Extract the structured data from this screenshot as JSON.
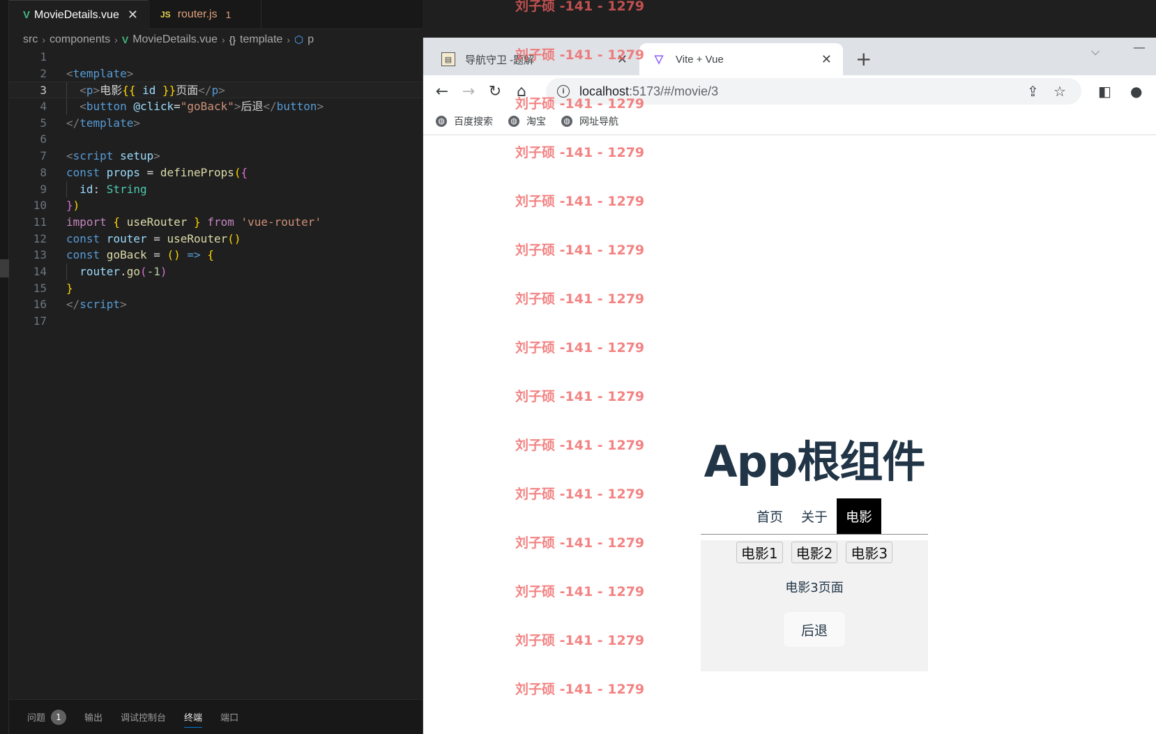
{
  "editor": {
    "tabs": [
      {
        "label": "MovieDetails.vue",
        "icon": "vue-icon",
        "active": true
      },
      {
        "label": "router.js",
        "icon": "js-icon",
        "problems": "1"
      }
    ],
    "breadcrumb": [
      "src",
      "components",
      "MovieDetails.vue",
      "template",
      "p"
    ],
    "line_numbers": [
      "1",
      "2",
      "3",
      "4",
      "5",
      "6",
      "7",
      "8",
      "9",
      "10",
      "11",
      "12",
      "13",
      "14",
      "15",
      "16",
      "17"
    ],
    "code": {
      "l2_open": "<",
      "l2_tag": "template",
      "l2_close": ">",
      "l3_open": "<",
      "l3_tag": "p",
      "l3_close": ">",
      "l3_text1": "电影",
      "l3_mus_open": "{{ ",
      "l3_var": "id",
      "l3_mus_close": " }}",
      "l3_text2": "页面",
      "l3_end_open": "</",
      "l3_end_tag": "p",
      "l3_end_close": ">",
      "l4_open": "<",
      "l4_tag": "button",
      "l4_attr": " @click",
      "l4_eq": "=",
      "l4_str": "\"goBack\"",
      "l4_close": ">",
      "l4_text": "后退",
      "l4_end_open": "</",
      "l4_end_tag": "button",
      "l4_end_close": ">",
      "l5_open": "</",
      "l5_tag": "template",
      "l5_close": ">",
      "l7_open": "<",
      "l7_tag": "script",
      "l7_attr": " setup",
      "l7_close": ">",
      "l8_kw": "const",
      "l8_var": " props",
      "l8_eq": " = ",
      "l8_fn": "defineProps",
      "l8_p": "(",
      "l8_b": "{",
      "l9_key": "id",
      "l9_colon": ": ",
      "l9_type": "String",
      "l10_b": "}",
      "l10_p": ")",
      "l11_kw": "import",
      "l11_b1": " { ",
      "l11_fn": "useRouter",
      "l11_b2": " } ",
      "l11_from": "from",
      "l11_str": " 'vue-router'",
      "l12_kw": "const",
      "l12_var": " router",
      "l12_eq": " = ",
      "l12_fn": "useRouter",
      "l12_p": "()",
      "l13_kw": "const",
      "l13_fn": " goBack",
      "l13_eq": " = ",
      "l13_p": "()",
      "l13_arrow": " =>",
      "l13_b": " {",
      "l14_var": "router",
      "l14_dot": ".",
      "l14_fn": "go",
      "l14_p1": "(",
      "l14_num": "-1",
      "l14_p2": ")",
      "l15_b": "}",
      "l16_open": "</",
      "l16_tag": "script",
      "l16_close": ">"
    },
    "panel_tabs": [
      "问题",
      "输出",
      "调试控制台",
      "终端",
      "端口"
    ],
    "problems_count": "1"
  },
  "browser": {
    "tabs": [
      {
        "title": "导航守卫 -题解",
        "active": false
      },
      {
        "title": "Vite + Vue",
        "active": true
      }
    ],
    "url_host": "localhost",
    "url_path": ":5173/#/movie/3",
    "bookmarks": [
      "百度搜索",
      "淘宝",
      "网址导航"
    ]
  },
  "app": {
    "title": "App根组件",
    "nav": [
      "首页",
      "关于",
      "电影"
    ],
    "movie_links": [
      "电影1",
      "电影2",
      "电影3"
    ],
    "movie_text": "电影3页面",
    "back_label": "后退"
  },
  "watermark": {
    "text": "刘子硕 -141 - 1279",
    "count": 15
  },
  "colors": {
    "editor_bg": "#1f1f1f",
    "vue_green": "#42b883",
    "active_nav_bg": "#000000",
    "heading": "#213547",
    "watermark": "#f05f5f"
  }
}
